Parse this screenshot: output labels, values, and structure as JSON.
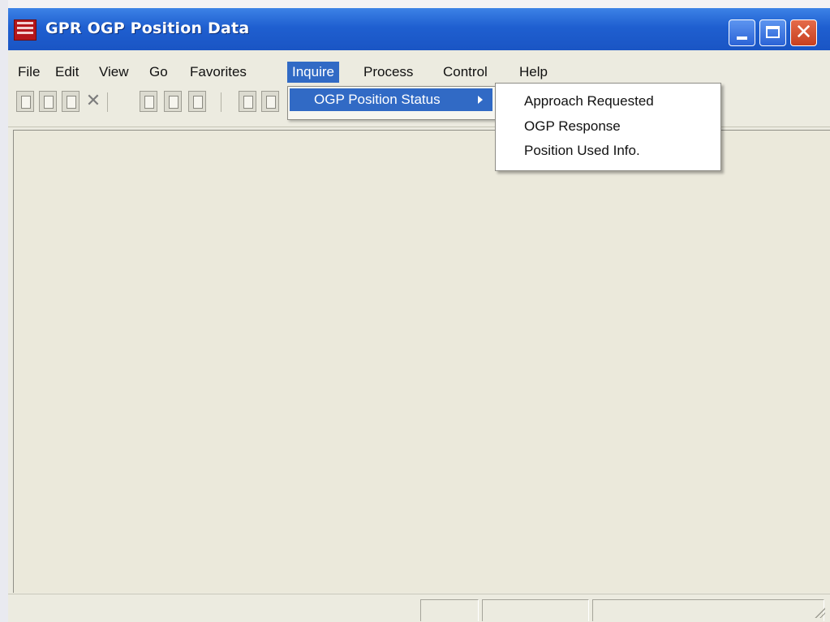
{
  "window": {
    "title": "GPR  OGP Position Data"
  },
  "menubar": {
    "items": [
      "File",
      "Edit",
      "View",
      "Go",
      "Favorites",
      "Inquire",
      "Process",
      "Control",
      "Help"
    ],
    "active": "Inquire"
  },
  "inquire_menu": {
    "items": [
      {
        "label": "OGP Position Status",
        "has_submenu": true
      }
    ]
  },
  "submenu": {
    "items": [
      "Approach Requested",
      "OGP Response",
      "Position Used Info."
    ]
  },
  "colors": {
    "title_bar": "#1f5fd0",
    "menu_highlight": "#316ac5",
    "window_bg": "#ecebe0"
  },
  "toolbar": {
    "icons": [
      "save-icon",
      "delete-record-icon",
      "delete-all-icon",
      "cancel-icon",
      "insert-before-icon",
      "insert-after-icon",
      "page-icon",
      "copy-icon",
      "paste-icon"
    ]
  }
}
